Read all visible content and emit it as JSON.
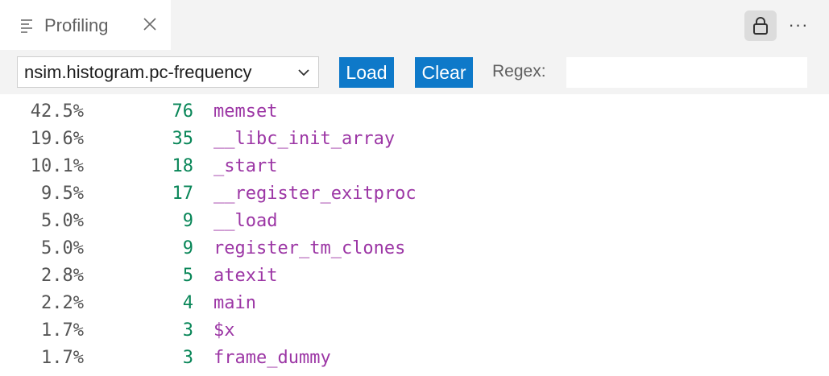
{
  "tab": {
    "title": "Profiling",
    "icon": "list-icon",
    "close_icon": "close-icon"
  },
  "actions": {
    "lock_icon": "lock-icon",
    "more_icon": "ellipsis-icon",
    "more_glyph": "···"
  },
  "toolbar": {
    "selected_source": "nsim.histogram.pc-frequency",
    "load_label": "Load",
    "clear_label": "Clear",
    "regex_label": "Regex:",
    "regex_value": ""
  },
  "colors": {
    "accent": "#0e79c9",
    "count": "#098658",
    "function": "#9c36a5",
    "percent": "#555555"
  },
  "rows": [
    {
      "percent": "42.5%",
      "count": "76",
      "function": "memset"
    },
    {
      "percent": "19.6%",
      "count": "35",
      "function": "__libc_init_array"
    },
    {
      "percent": "10.1%",
      "count": "18",
      "function": "_start"
    },
    {
      "percent": "9.5%",
      "count": "17",
      "function": "__register_exitproc"
    },
    {
      "percent": "5.0%",
      "count": "9",
      "function": "__load"
    },
    {
      "percent": "5.0%",
      "count": "9",
      "function": "register_tm_clones"
    },
    {
      "percent": "2.8%",
      "count": "5",
      "function": "atexit"
    },
    {
      "percent": "2.2%",
      "count": "4",
      "function": "main"
    },
    {
      "percent": "1.7%",
      "count": "3",
      "function": "$x"
    },
    {
      "percent": "1.7%",
      "count": "3",
      "function": "frame_dummy"
    }
  ]
}
